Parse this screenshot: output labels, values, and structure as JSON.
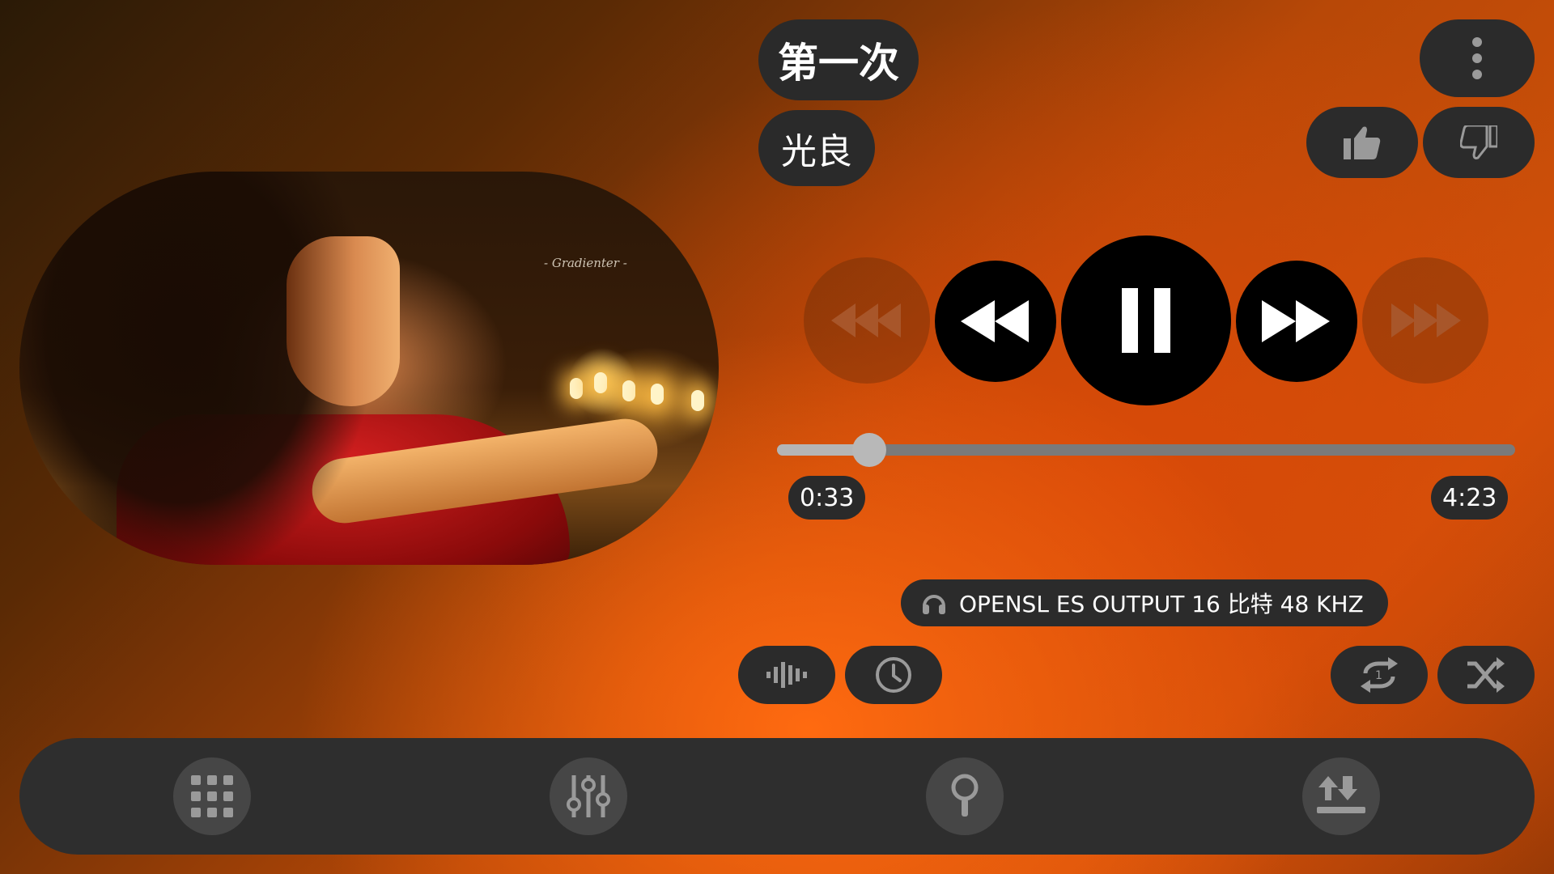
{
  "track": {
    "title": "第一次",
    "artist": "光良"
  },
  "art": {
    "watermark": "- Gradienter -"
  },
  "playback": {
    "elapsed": "0:33",
    "duration": "4:23",
    "progress": 0.1255
  },
  "output": {
    "label": "OPENSL ES OUTPUT  16 比特  48 KHZ"
  },
  "icons": {
    "more": "more-vert-icon",
    "like": "thumb-up-icon",
    "dislike": "thumb-down-icon",
    "skip_back": "skip-previous-icon",
    "rewind": "rewind-icon",
    "pause": "pause-icon",
    "fast_forward": "fast-forward-icon",
    "skip_next": "skip-next-icon",
    "output": "headphones-icon",
    "equalizer": "waveform-icon",
    "sleep_timer": "clock-icon",
    "repeat": "repeat-one-icon",
    "shuffle": "shuffle-icon",
    "nav_library": "grid-icon",
    "nav_equalizer": "tune-sliders-icon",
    "nav_search": "search-icon",
    "nav_queue": "upload-sort-icon"
  },
  "colors": {
    "accent": "#d2520a",
    "button_bg": "#2b2b2b",
    "control_black": "#000000",
    "icon_grey": "#9a9a9a"
  }
}
